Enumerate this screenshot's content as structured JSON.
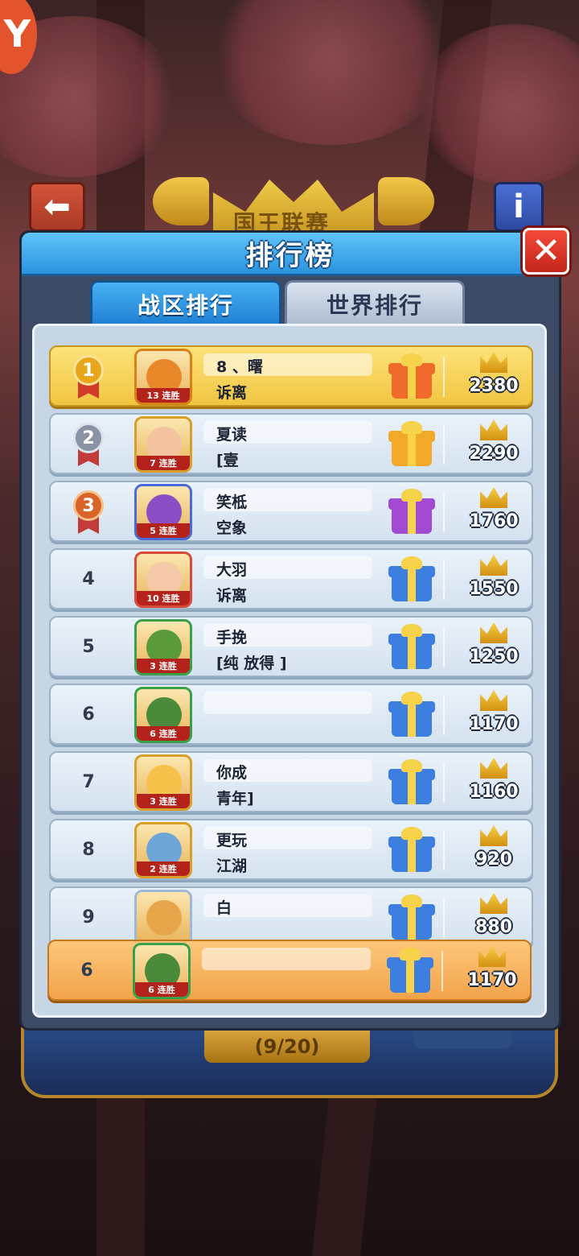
{
  "league_title": "国王联赛",
  "panel_title": "排行榜",
  "tabs": [
    {
      "label": "战区排行",
      "active": true
    },
    {
      "label": "世界排行",
      "active": false
    }
  ],
  "rows": [
    {
      "rank": "1",
      "medal": "gold",
      "streak": "13 连胜",
      "name": "8 、曙",
      "guild": "诉离",
      "gift": "orange",
      "score": "2380"
    },
    {
      "rank": "2",
      "medal": "silver",
      "streak": "7 连胜",
      "name": "夏读",
      "guild": "[壹",
      "gift": "gold",
      "score": "2290"
    },
    {
      "rank": "3",
      "medal": "bronze",
      "streak": "5 连胜",
      "name": "笑柢",
      "guild": "空象",
      "gift": "purple",
      "score": "1760"
    },
    {
      "rank": "4",
      "medal": "",
      "streak": "10 连胜",
      "name": "大羽",
      "guild": "诉离",
      "gift": "blue",
      "score": "1550"
    },
    {
      "rank": "5",
      "medal": "",
      "streak": "3 连胜",
      "name": "手挽",
      "guild": "[纯 放得 ]",
      "gift": "blue",
      "score": "1250"
    },
    {
      "rank": "6",
      "medal": "",
      "streak": "6 连胜",
      "name": "",
      "guild": "",
      "gift": "blue",
      "score": "1170"
    },
    {
      "rank": "7",
      "medal": "",
      "streak": "3 连胜",
      "name": "你成",
      "guild": "青年]",
      "gift": "blue",
      "score": "1160"
    },
    {
      "rank": "8",
      "medal": "",
      "streak": "2 连胜",
      "name": "更玩",
      "guild": "江湖",
      "gift": "blue",
      "score": "920"
    },
    {
      "rank": "9",
      "medal": "",
      "streak": "",
      "name": "白",
      "guild": "",
      "gift": "blue",
      "score": "880"
    }
  ],
  "my_row": {
    "rank": "6",
    "streak": "6 连胜",
    "name": "",
    "guild": "",
    "gift": "blue",
    "score": "1170"
  },
  "pager": "(9/20)",
  "colors": {
    "header_blue": "#2a93df",
    "first_row": "#f1c540",
    "my_row": "#f1a34a",
    "close_red": "#c3261c"
  },
  "icons": [
    "back-arrow-icon",
    "info-icon",
    "close-icon",
    "gift-icon",
    "crown-icon",
    "medal-icon"
  ]
}
